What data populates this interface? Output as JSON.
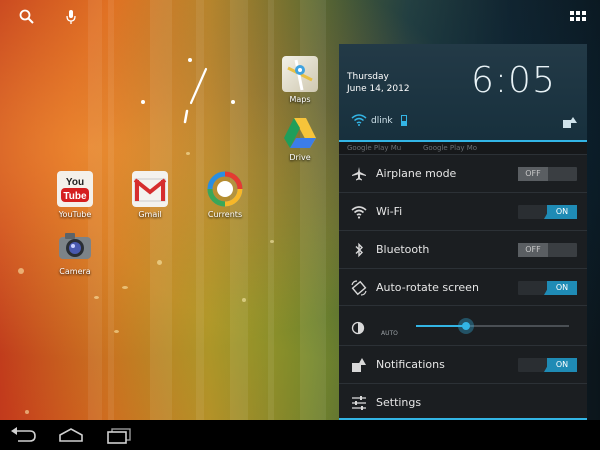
{
  "status_bar": {
    "search_icon": "search-icon",
    "voice_icon": "mic-icon",
    "all_apps_icon": "grid-icon"
  },
  "home_screen": {
    "apps": [
      {
        "label": "Maps",
        "icon": "maps-icon"
      },
      {
        "label": "Drive",
        "icon": "drive-icon"
      },
      {
        "label": "YouTube",
        "icon": "youtube-icon"
      },
      {
        "label": "Gmail",
        "icon": "gmail-icon"
      },
      {
        "label": "Currents",
        "icon": "currents-icon"
      },
      {
        "label": "Camera",
        "icon": "camera-icon"
      }
    ]
  },
  "panel": {
    "day": "Thursday",
    "date": "June 14, 2012",
    "time": "6:05",
    "wifi_network": "dlink",
    "peek_items": [
      "Google Play Mu",
      "Google Play Mo"
    ],
    "quick_settings": [
      {
        "label": "Airplane mode",
        "icon": "airplane-icon",
        "state": "OFF"
      },
      {
        "label": "Wi-Fi",
        "icon": "wifi-icon",
        "state": "ON"
      },
      {
        "label": "Bluetooth",
        "icon": "bluetooth-icon",
        "state": "OFF"
      },
      {
        "label": "Auto-rotate screen",
        "icon": "rotate-icon",
        "state": "ON"
      }
    ],
    "brightness": {
      "auto_label": "AUTO",
      "level": 0.33
    },
    "notifications": {
      "label": "Notifications",
      "state": "ON"
    },
    "settings": {
      "label": "Settings"
    }
  },
  "colors": {
    "accent": "#33b5e5",
    "panel_bg": "#1b1e21",
    "toggle_on": "#1f8bb5"
  },
  "navigation": {
    "back_icon": "back-icon",
    "home_icon": "home-icon",
    "recents_icon": "recents-icon"
  }
}
